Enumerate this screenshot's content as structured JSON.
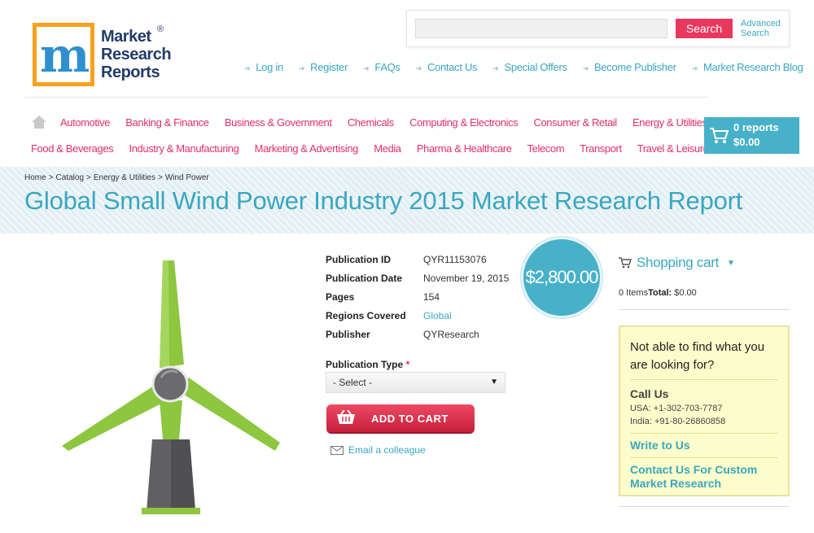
{
  "logo": {
    "letter": "m",
    "line1": "Market",
    "line2": "Research",
    "line3": "Reports",
    "registered": "®",
    "colors": {
      "border": "#f6a21d",
      "text": "#233b68"
    }
  },
  "search": {
    "value": "",
    "button_label": "Search",
    "advanced_line1": "Advanced",
    "advanced_line2": "Search"
  },
  "topnav": {
    "items": [
      {
        "label": "Log in"
      },
      {
        "label": "Register"
      },
      {
        "label": "FAQs"
      },
      {
        "label": "Contact Us"
      },
      {
        "label": "Special Offers"
      },
      {
        "label": "Become Publisher"
      },
      {
        "label": "Market Research Blog"
      }
    ]
  },
  "categories": {
    "row1": [
      {
        "label": "Automotive"
      },
      {
        "label": "Banking & Finance"
      },
      {
        "label": "Business & Government"
      },
      {
        "label": "Chemicals"
      },
      {
        "label": "Computing & Electronics"
      },
      {
        "label": "Consumer & Retail"
      },
      {
        "label": "Energy & Utilities"
      }
    ],
    "row2": [
      {
        "label": "Food & Beverages"
      },
      {
        "label": "Industry & Manufacturing"
      },
      {
        "label": "Marketing & Advertising"
      },
      {
        "label": "Media"
      },
      {
        "label": "Pharma & Healthcare"
      },
      {
        "label": "Telecom"
      },
      {
        "label": "Transport"
      },
      {
        "label": "Travel & Leisure"
      }
    ]
  },
  "cart_summary": {
    "reports": "0 reports",
    "amount": "$0.00"
  },
  "breadcrumb": {
    "items": [
      "Home",
      "Catalog",
      "Energy & Utilities",
      "Wind Power"
    ],
    "separator": ">"
  },
  "page_title": "Global Small Wind Power Industry 2015 Market Research Report",
  "product": {
    "image_icon": "wind-turbine-icon",
    "details": [
      {
        "label": "Publication ID",
        "value": "QYR11153076"
      },
      {
        "label": "Publication Date",
        "value": "November 19, 2015"
      },
      {
        "label": "Pages",
        "value": "154"
      },
      {
        "label": "Regions Covered",
        "value": "Global"
      },
      {
        "label": "Publisher",
        "value": "QYResearch"
      }
    ],
    "price": "$2,800.00",
    "publication_type_label": "Publication Type",
    "required_mark": "*",
    "publication_type_selected": "- Select -",
    "add_to_cart_label": "ADD TO CART",
    "email_colleague": "Email a colleague"
  },
  "sidebar": {
    "cart_title": "Shopping cart",
    "items_text": "0 Items",
    "total_label": "Total:",
    "total_value": "$0.00",
    "help": {
      "question": "Not able to find what you are looking for?",
      "call_us": "Call Us",
      "usa_phone": "USA: +1-302-703-7787",
      "india_phone": "India: +91-80-26860858",
      "write_to_us": "Write to Us",
      "custom_research": "Contact Us For Custom Market Research"
    }
  },
  "colors": {
    "accent_blue": "#3aa7c0",
    "category_pink": "#e0306a",
    "cart_blue": "#47b1c9",
    "add_to_cart_red": "#d8304c",
    "turbine_green": "#8dc63f",
    "help_bg": "#fdfccb"
  }
}
